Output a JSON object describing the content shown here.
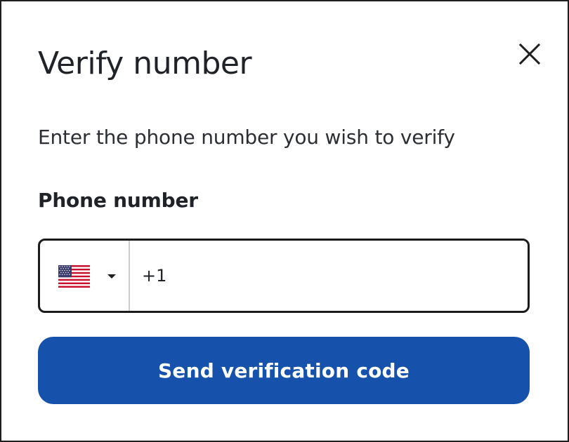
{
  "dialog": {
    "title": "Verify number",
    "description": "Enter the phone number you wish to verify",
    "close_icon": "close-icon"
  },
  "phone_field": {
    "label": "Phone number",
    "country": "United States",
    "flag_icon": "us-flag-icon",
    "dropdown_icon": "caret-down-icon",
    "value": "+1"
  },
  "actions": {
    "send_label": "Send verification code"
  },
  "colors": {
    "primary_button": "#1652ab",
    "text": "#1f2328",
    "field_border": "#1b1b1b",
    "divider": "#c9cdd1"
  }
}
